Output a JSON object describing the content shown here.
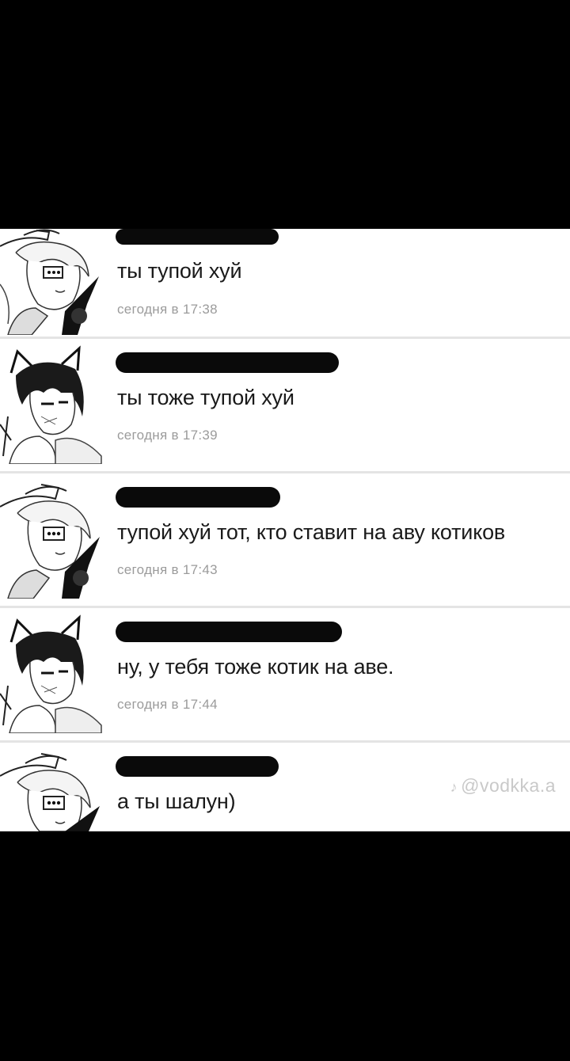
{
  "messages": [
    {
      "avatar": "hat-boy-avatar",
      "text": "ты тупой хуй",
      "time": "сегодня в 17:38"
    },
    {
      "avatar": "cat-ears-avatar",
      "text": "ты тоже тупой хуй",
      "time": "сегодня в 17:39"
    },
    {
      "avatar": "hat-boy-avatar",
      "text": "тупой хуй тот, кто ставит на аву котиков",
      "time": "сегодня в 17:43"
    },
    {
      "avatar": "cat-ears-avatar",
      "text": "ну, у тебя тоже котик на аве.",
      "time": "сегодня в 17:44"
    },
    {
      "avatar": "hat-boy-avatar",
      "text": "а ты шалун)",
      "time": ""
    }
  ],
  "watermark": {
    "icon": "tiktok-icon",
    "handle": "@vodkka.a"
  },
  "colors": {
    "background": "#000000",
    "panel": "#ffffff",
    "redaction": "#0a0a0a",
    "timestamp": "#9b9b9b"
  }
}
